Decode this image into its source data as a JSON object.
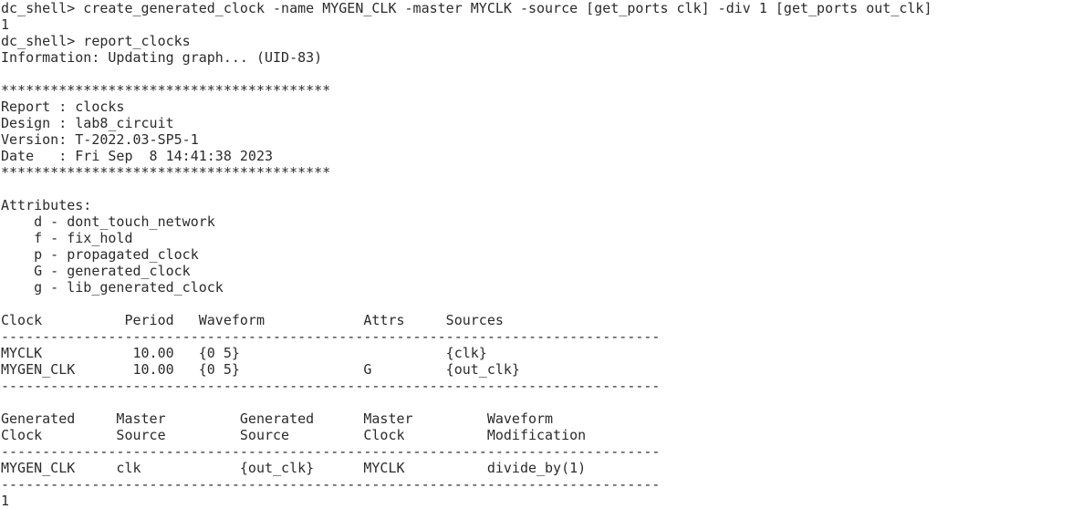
{
  "terminal": {
    "lines": [
      "dc_shell> create_generated_clock -name MYGEN_CLK -master MYCLK -source [get_ports clk] -div 1 [get_ports out_clk]",
      "1",
      "dc_shell> report_clocks",
      "Information: Updating graph... (UID-83)",
      "",
      "****************************************",
      "Report : clocks",
      "Design : lab8_circuit",
      "Version: T-2022.03-SP5-1",
      "Date   : Fri Sep  8 14:41:38 2023",
      "****************************************",
      "",
      "Attributes:",
      "    d - dont_touch_network",
      "    f - fix_hold",
      "    p - propagated_clock",
      "    G - generated_clock",
      "    g - lib_generated_clock",
      "",
      "Clock          Period   Waveform            Attrs     Sources",
      "--------------------------------------------------------------------------------",
      "MYCLK           10.00   {0 5}                         {clk}",
      "MYGEN_CLK       10.00   {0 5}               G         {out_clk}",
      "--------------------------------------------------------------------------------",
      "",
      "Generated     Master         Generated      Master         Waveform",
      "Clock         Source         Source         Clock          Modification",
      "--------------------------------------------------------------------------------",
      "MYGEN_CLK     clk            {out_clk}      MYCLK          divide_by(1)",
      "--------------------------------------------------------------------------------",
      "1"
    ]
  }
}
